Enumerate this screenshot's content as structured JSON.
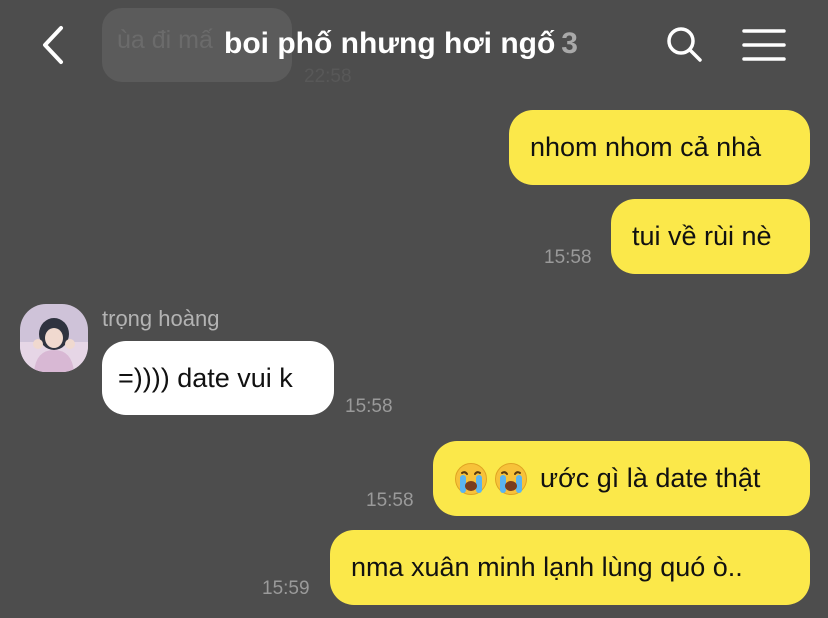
{
  "header": {
    "title": "boi phố nhưng hơi ngố",
    "member_count": "3",
    "back_icon": "chevron-left-icon",
    "search_icon": "search-icon",
    "menu_icon": "hamburger-menu-icon"
  },
  "ghost": {
    "text": "ùa đi mấ",
    "time": "22:58"
  },
  "messages": [
    {
      "text": "nhom nhom cả nhà",
      "time": ""
    },
    {
      "text": "tui về rùi nè",
      "time": "15:58"
    },
    {
      "sender": "trọng hoàng",
      "text": "=)))) date vui k",
      "time": "15:58"
    },
    {
      "emoji": "😭😭",
      "text": "ước gì là date thật",
      "time": "15:58"
    },
    {
      "text": "nma xuân minh lạnh lùng quó ò..",
      "time": "15:59"
    }
  ],
  "colors": {
    "background": "#4d4d4d",
    "outgoing_bubble": "#fbe84a",
    "incoming_bubble": "#ffffff",
    "timestamp": "#9a9a9a"
  }
}
